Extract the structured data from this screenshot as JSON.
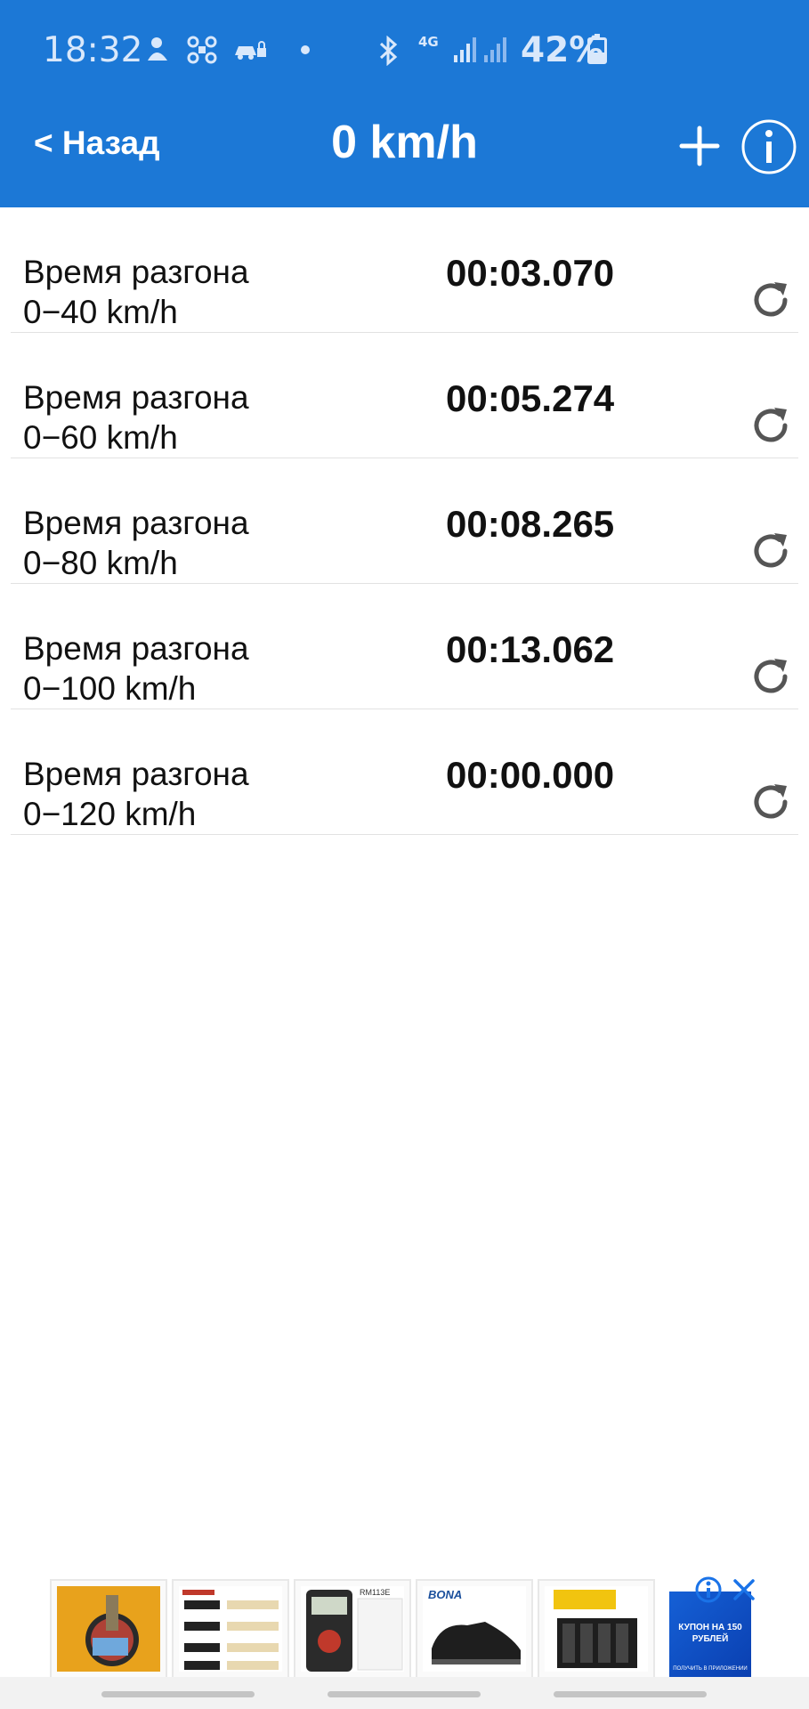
{
  "status_bar": {
    "time": "18:32",
    "network": "4G",
    "battery": "42%",
    "battery_level": 0.42
  },
  "nav": {
    "back_label": "< Назад",
    "title": "0 km/h"
  },
  "rows": [
    {
      "label_line1": "Время разгона",
      "label_line2": "0−40 km/h",
      "time": "00:03.070"
    },
    {
      "label_line1": "Время разгона",
      "label_line2": "0−60 km/h",
      "time": "00:05.274"
    },
    {
      "label_line1": "Время разгона",
      "label_line2": "0−80 km/h",
      "time": "00:08.265"
    },
    {
      "label_line1": "Время разгона",
      "label_line2": "0−100 km/h",
      "time": "00:13.062"
    },
    {
      "label_line1": "Время разгона",
      "label_line2": "0−120 km/h",
      "time": "00:00.000"
    }
  ],
  "ads": {
    "brand_shoes": "BONA",
    "multimeter_model": "RM113E",
    "coupon_text": "КУПОН НА 150 РУБЛЕЙ",
    "coupon_sub": "ПОЛУЧИТЬ В ПРИЛОЖЕНИИ"
  },
  "colors": {
    "app_bar": "#1c78d6",
    "text": "#111111",
    "divider": "#e2e2e2",
    "reset_icon": "#555555"
  },
  "icons": {
    "add": "plus-icon",
    "info": "info-icon",
    "reset": "refresh-icon"
  }
}
